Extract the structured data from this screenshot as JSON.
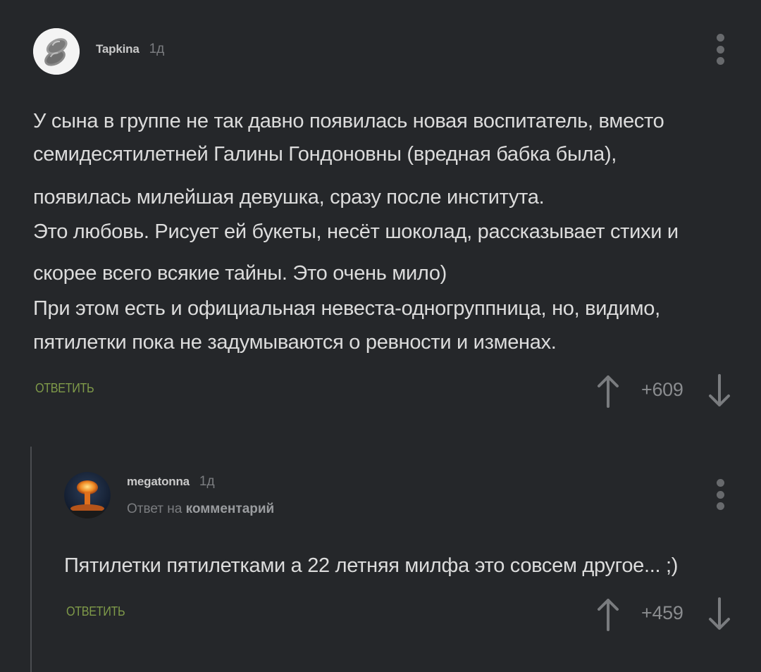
{
  "comments": [
    {
      "username": "Tapkina",
      "time": "1д",
      "text_lines": [
        "У сына в группе не так давно появилась новая воспитатель, вместо",
        "семидесятилетней Галины Гондоновны (вредная бабка была),",
        "появилась милейшая девушка, сразу после института.",
        "Это любовь. Рисует ей букеты, несёт шоколад, рассказывает стихи и",
        "скорее всего всякие тайны. Это очень мило)",
        "При этом есть и официальная невеста-одногруппница, но, видимо,",
        "пятилетки пока не задумываются о ревности и изменах."
      ],
      "reply_label": "ответить",
      "rating": "+609"
    },
    {
      "username": "megatonna",
      "time": "1д",
      "reply_prefix": "Ответ на",
      "reply_target": "комментарий",
      "text_lines": [
        "Пятилетки пятилетками а 22 летняя милфа это совсем другое... ;)"
      ],
      "reply_label": "ответить",
      "rating": "+459"
    }
  ],
  "icons": {
    "avatar_1": "slippers-avatar",
    "avatar_2": "mushroom-cloud-avatar",
    "menu": "kebab-menu-icon",
    "upvote": "arrow-up-icon",
    "downvote": "arrow-down-icon"
  },
  "colors": {
    "background": "#25272a",
    "text": "#dcdcdc",
    "muted": "#7b7d80",
    "accent_green": "#7f9a49",
    "thread_line": "#4a4c50"
  }
}
